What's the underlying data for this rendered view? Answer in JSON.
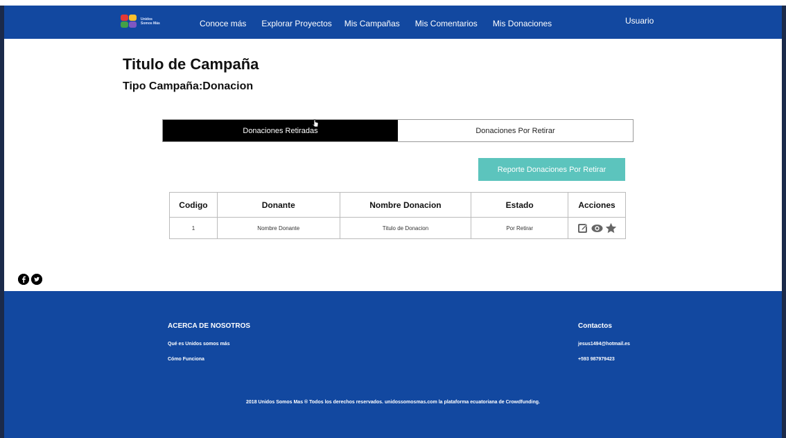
{
  "nav": {
    "logo_line1": "Unidos",
    "logo_line2": "Somos Más",
    "links": [
      "Conoce más",
      "Explorar Proyectos",
      "Mis Campañas",
      "Mis Comentarios",
      "Mis Donaciones"
    ],
    "user": "Usuario"
  },
  "page": {
    "title": "Titulo de Campaña",
    "subtitle": "Tipo Campaña:Donacion"
  },
  "tabs": {
    "active": "Donaciones Retiradas",
    "inactive": "Donaciones Por Retirar"
  },
  "report_button": "Reporte Donaciones Por Retirar",
  "table": {
    "headers": [
      "Codigo",
      "Donante",
      "Nombre Donacion",
      "Estado",
      "Acciones"
    ],
    "rows": [
      [
        "1",
        "Nombre Donante",
        "Titulo de Donacion",
        "Por Retirar"
      ]
    ],
    "action_icons": [
      "edit-icon",
      "eye-icon",
      "star-icon"
    ]
  },
  "social_icons": [
    "facebook-icon",
    "twitter-icon"
  ],
  "footer": {
    "about_title": "ACERCA DE NOSOTROS",
    "about_links": [
      "Qué es Unidos somos más",
      "Cómo Funciona"
    ],
    "contact_title": "Contactos",
    "email": "jesus1494@hotmail.es",
    "phone": "+593 987979423",
    "copyright": "2018 Unidos Somos Mas ® Todos los derechos reservados. unidossomosmas.com la plataforma ecuatoriana de Crowdfunding."
  },
  "colors": {
    "navbar": "#1248a0",
    "footer": "#1248a0",
    "report_button": "#5cc4bd",
    "active_tab": "#000000"
  }
}
